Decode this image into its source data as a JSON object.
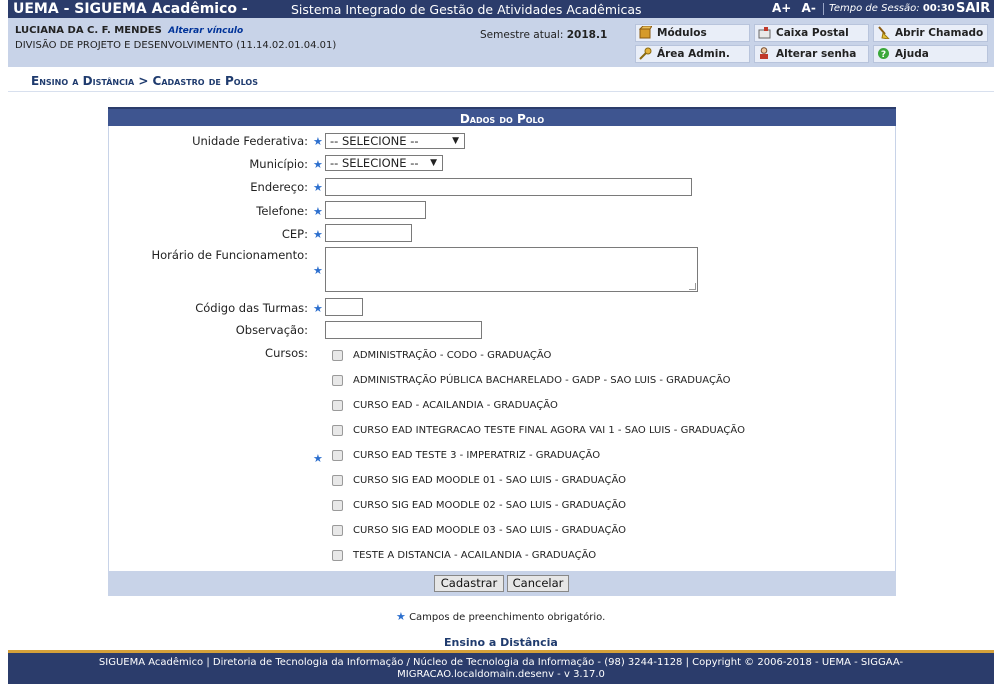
{
  "header": {
    "system_name": "UEMA - SIGUEMA Acadêmico -",
    "subtitle": "Sistema Integrado de Gestão de Atividades Acadêmicas",
    "font_increase": "A+",
    "font_decrease": "A-",
    "session_label": "Tempo de Sessão:",
    "session_time": "00:30",
    "logout": "SAIR"
  },
  "user": {
    "name": "LUCIANA DA C. F. MENDES",
    "change_link": "Alterar vínculo",
    "unit": "DIVISÃO DE PROJETO E DESENVOLVIMENTO (11.14.02.01.04.01)",
    "semester_label": "Semestre atual:",
    "semester_value": "2018.1"
  },
  "quick_links": {
    "modulos": "Módulos",
    "caixa_postal": "Caixa Postal",
    "abrir_chamado": "Abrir Chamado",
    "area_admin": "Área Admin.",
    "alterar_senha": "Alterar senha",
    "ajuda": "Ajuda"
  },
  "breadcrumb": "Ensino a Distância > Cadastro de Polos",
  "form": {
    "caption": "Dados do Polo",
    "labels": {
      "uf": "Unidade Federativa:",
      "municipio": "Município:",
      "endereco": "Endereço:",
      "telefone": "Telefone:",
      "cep": "CEP:",
      "horario": "Horário de Funcionamento:",
      "codigo": "Código das Turmas:",
      "observacao": "Observação:",
      "cursos": "Cursos:"
    },
    "uf_value": "-- SELECIONE --",
    "municipio_value": "-- SELECIONE --",
    "courses": [
      "ADMINISTRAÇÃO - CODO - GRADUAÇÃO",
      "ADMINISTRAÇÃO PÚBLICA BACHARELADO - GADP - SAO LUIS - GRADUAÇÃO",
      "CURSO EAD - ACAILANDIA - GRADUAÇÃO",
      "CURSO EAD INTEGRACAO TESTE FINAL AGORA VAI 1 - SAO LUIS - GRADUAÇÃO",
      "CURSO EAD TESTE 3 - IMPERATRIZ - GRADUAÇÃO",
      "CURSO SIG EAD MOODLE 01 - SAO LUIS - GRADUAÇÃO",
      "CURSO SIG EAD MOODLE 02 - SAO LUIS - GRADUAÇÃO",
      "CURSO SIG EAD MOODLE 03 - SAO LUIS - GRADUAÇÃO",
      "TESTE A DISTANCIA - ACAILANDIA - GRADUAÇÃO"
    ],
    "submit": "Cadastrar",
    "cancel": "Cancelar"
  },
  "required_marker": "★",
  "required_note": "Campos de preenchimento obrigatório.",
  "footer_link": "Ensino a Distância",
  "footer": {
    "line1": "SIGUEMA Acadêmico | Diretoria de Tecnologia da Informação / Núcleo de Tecnologia da Informação - (98) 3244-1128 | Copyright © 2006-2018 - UEMA - SIGGAA-",
    "line2": "MIGRACAO.localdomain.desenv - v 3.17.0"
  },
  "colors": {
    "header_bg": "#2b3c6b",
    "info_bg": "#c8d3e8",
    "caption_bg": "#3e5590",
    "required_star": "#2c6fce",
    "footer_accent": "#d5a13a"
  }
}
